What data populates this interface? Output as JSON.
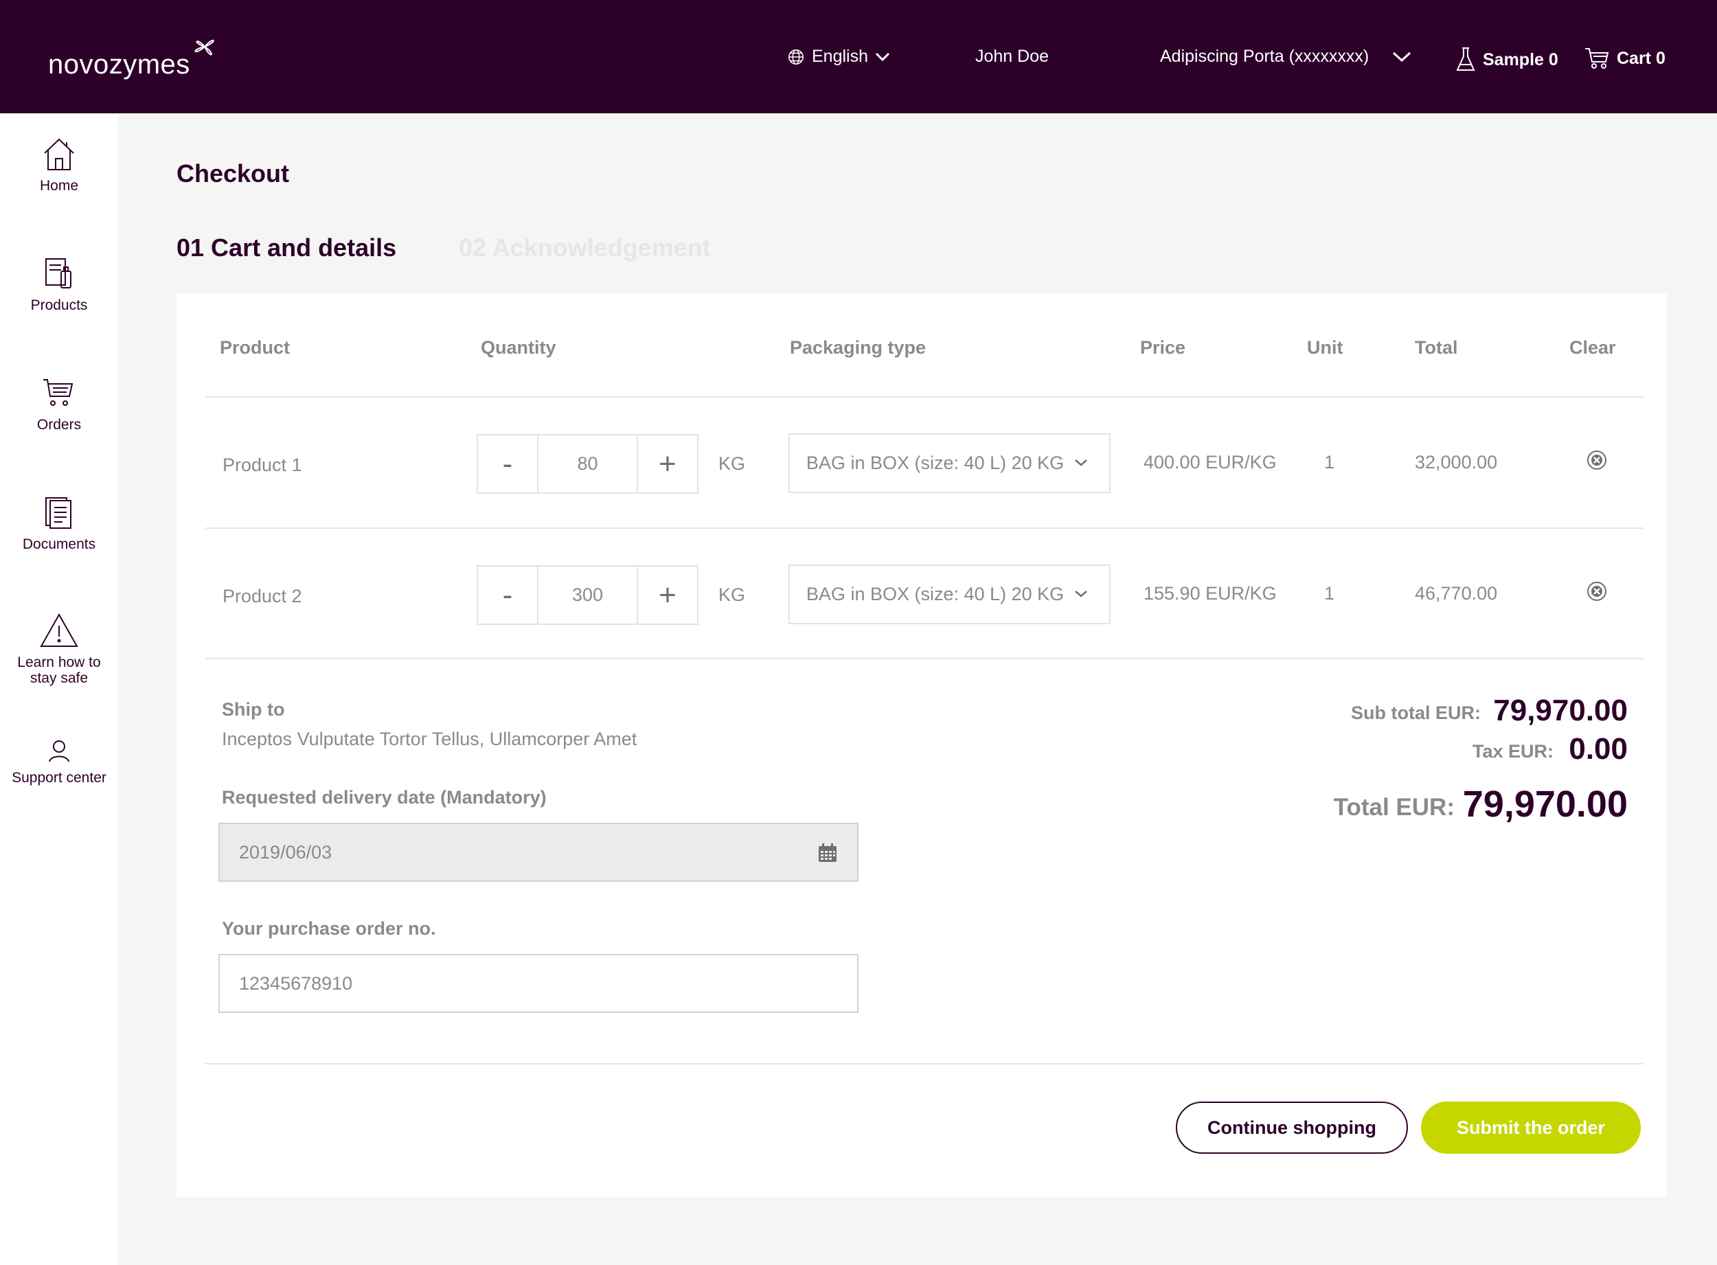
{
  "header": {
    "brand": "novozymes",
    "language": "English",
    "user": "John Doe",
    "account": "Adipiscing Porta (xxxxxxxx)",
    "sample_label": "Sample 0",
    "cart_label": "Cart 0"
  },
  "sidebar": {
    "items": [
      {
        "label": "Home",
        "icon": "home-icon"
      },
      {
        "label": "Products",
        "icon": "products-icon"
      },
      {
        "label": "Orders",
        "icon": "orders-icon"
      },
      {
        "label": "Documents",
        "icon": "documents-icon"
      },
      {
        "label_line1": "Learn how to",
        "label_line2": "stay safe",
        "icon": "warning-icon"
      },
      {
        "label": "Support center",
        "icon": "support-icon"
      }
    ]
  },
  "page": {
    "title": "Checkout",
    "steps": [
      "01 Cart and details",
      "02 Acknowledgement"
    ]
  },
  "table": {
    "headers": [
      "Product",
      "Quantity",
      "Packaging type",
      "Price",
      "Unit",
      "Total",
      "Clear"
    ],
    "rows": [
      {
        "product": "Product 1",
        "minus": "-",
        "quantity": "80",
        "plus": "+",
        "unit_label": "KG",
        "packaging": "BAG in BOX (size: 40 L) 20 KG",
        "price": "400.00 EUR/KG",
        "unit": "1",
        "total": "32,000.00"
      },
      {
        "product": "Product 2",
        "minus": "-",
        "quantity": "300",
        "plus": "+",
        "unit_label": "KG",
        "packaging": "BAG in BOX (size: 40 L) 20 KG",
        "price": "155.90 EUR/KG",
        "unit": "1",
        "total": "46,770.00"
      }
    ]
  },
  "details": {
    "ship_to_label": "Ship to",
    "ship_to_value": "Inceptos Vulputate Tortor Tellus, Ullamcorper Amet",
    "delivery_label": "Requested delivery date (Mandatory)",
    "delivery_value": "2019/06/03",
    "po_label": "Your purchase order no.",
    "po_value": "12345678910"
  },
  "summary": {
    "subtotal_label": "Sub total EUR:",
    "subtotal_value": "79,970.00",
    "tax_label": "Tax EUR:",
    "tax_value": "0.00",
    "total_label": "Total EUR:",
    "total_value": "79,970.00"
  },
  "actions": {
    "continue_label": "Continue shopping",
    "submit_label": "Submit the order"
  },
  "colors": {
    "brand_purple": "#2d0029",
    "accent_lime": "#c5d600",
    "text_gray": "#8b8a8a"
  }
}
